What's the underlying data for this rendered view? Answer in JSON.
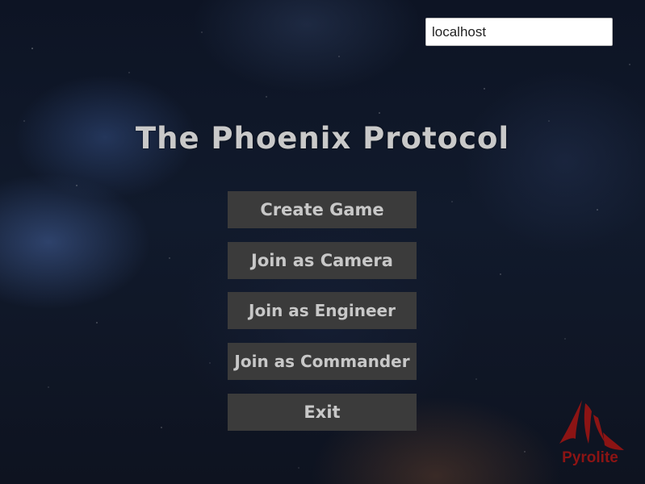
{
  "server": {
    "value": "localhost"
  },
  "title": "The Phoenix Protocol",
  "menu": {
    "create_game": "Create Game",
    "join_camera": "Join as Camera",
    "join_engineer": "Join as Engineer",
    "join_commander": "Join as Commander",
    "exit": "Exit"
  },
  "logo": {
    "text": "Pyrolite",
    "color": "#8c1414"
  },
  "colors": {
    "button_bg": "#3b3b3b",
    "button_text": "#c8c8c8",
    "title_text": "#c9c9c9"
  }
}
